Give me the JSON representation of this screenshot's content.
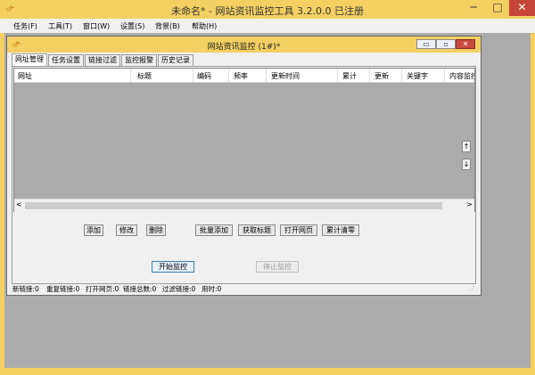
{
  "app": {
    "title": "未命名* - 网站资讯监控工具 3.2.0.0  已注册",
    "min": "─",
    "max": "□",
    "close": "✕"
  },
  "menu": [
    "任务(F)",
    "工具(T)",
    "窗口(W)",
    "设置(S)",
    "背景(B)",
    "帮助(H)"
  ],
  "child": {
    "title": "网站资讯监控  (1#)*",
    "min": "▭",
    "max": "▫",
    "close": "✕"
  },
  "tabs": [
    "网址管理",
    "任务设置",
    "链接过滤",
    "监控报警",
    "历史记录"
  ],
  "list": {
    "columns": [
      "网址",
      "标题",
      "编码",
      "频率",
      "更新时间",
      "累计",
      "更新",
      "关键字",
      "内容监控"
    ],
    "scroll_left": "<",
    "scroll_right": ">"
  },
  "side_buttons": {
    "up": "↑",
    "down": "↓"
  },
  "buttons": {
    "add": "添加",
    "edit": "修改",
    "delete": "删除",
    "batch_add": "批量添加",
    "get_title": "获取标题",
    "open_page": "打开网页",
    "clear_total": "累计清零",
    "start": "开始监控",
    "stop": "停止监控"
  },
  "status": {
    "new_links": "新链接:0",
    "dup_links": "重复链接:0",
    "open_pages": "打开网页:0",
    "total_links": "链接总数:0",
    "filtered": "过滤链接:0",
    "elapsed": "用时:0"
  },
  "colors": {
    "title_bar": "#f4d063",
    "workspace": "#ababab",
    "close": "#c7463a"
  },
  "icons": {
    "app": "bird-logo-icon",
    "child": "bird-logo-icon"
  }
}
